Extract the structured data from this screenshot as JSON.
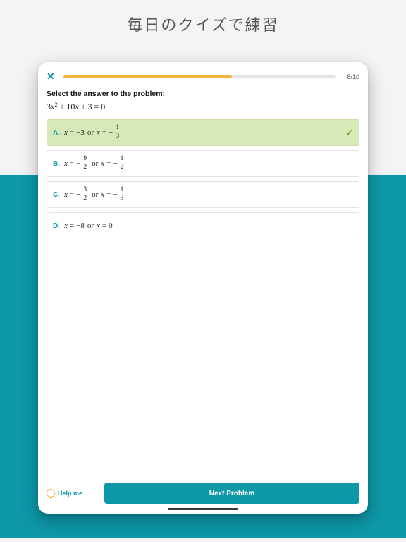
{
  "heading": "毎日のクイズで練習",
  "progress": {
    "current": 8,
    "total": 10,
    "label": "8/10",
    "percent": 62
  },
  "prompt": "Select the answer to the problem:",
  "equation_html": "3<i>x</i><sup>2</sup> + 10<i>x</i> + 3 = 0",
  "options": [
    {
      "letter": "A.",
      "correct": true,
      "parts": [
        "x",
        "=",
        "−3",
        "or",
        "x",
        "=",
        "neg",
        "frac:1:3"
      ]
    },
    {
      "letter": "B.",
      "correct": false,
      "parts": [
        "x",
        "=",
        "neg",
        "frac:9:2",
        "or",
        "x",
        "=",
        "neg",
        "frac:1:2"
      ]
    },
    {
      "letter": "C.",
      "correct": false,
      "parts": [
        "x",
        "=",
        "neg",
        "frac:3:2",
        "or",
        "x",
        "=",
        "neg",
        "frac:1:3"
      ]
    },
    {
      "letter": "D.",
      "correct": false,
      "parts": [
        "x",
        "=",
        "−8",
        "or",
        "x",
        "=",
        "0"
      ]
    }
  ],
  "buttons": {
    "help": "Help me",
    "next": "Next Problem"
  }
}
